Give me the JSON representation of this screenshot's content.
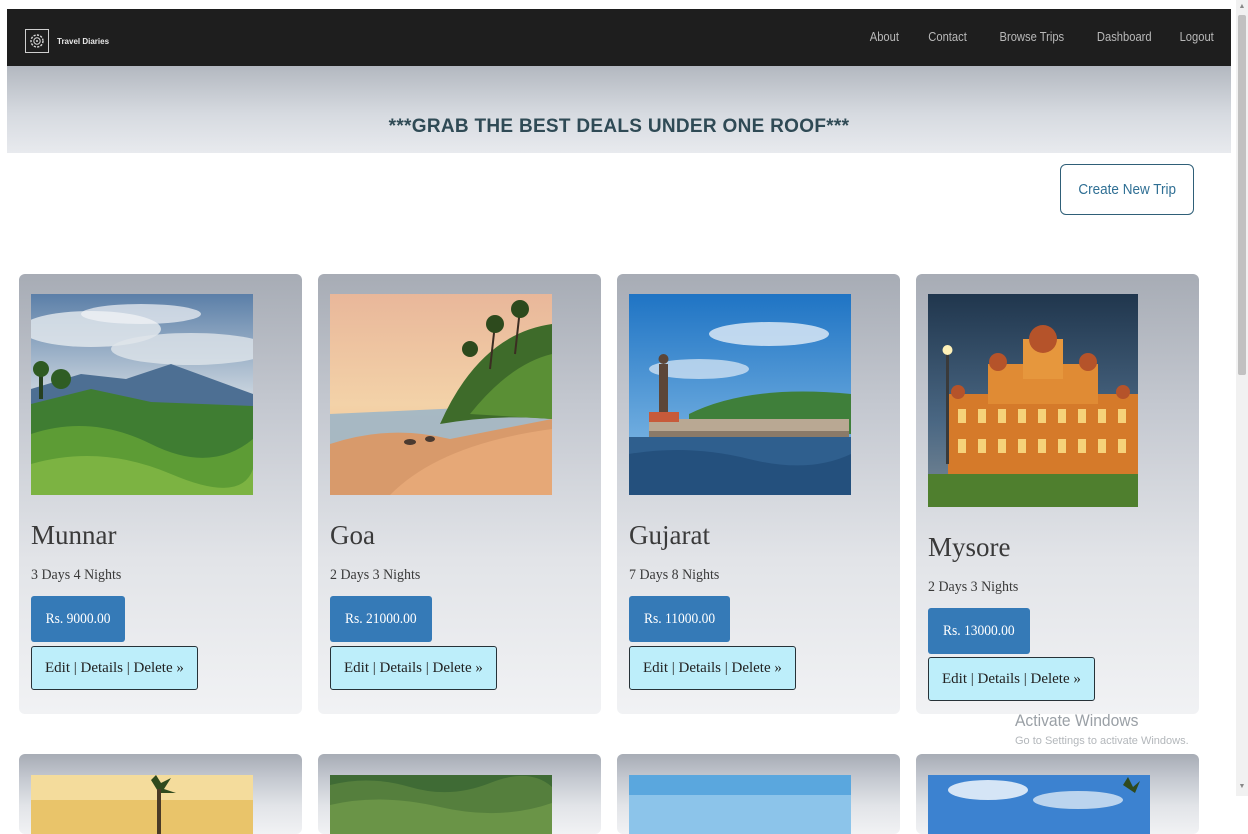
{
  "brand": {
    "name": "Travel Diaries",
    "icon": "gear-logo-icon"
  },
  "nav": {
    "items": [
      {
        "label": "About"
      },
      {
        "label": "Contact"
      },
      {
        "label": "Browse Trips"
      },
      {
        "label": "Dashboard"
      },
      {
        "label": "Logout"
      }
    ]
  },
  "banner": {
    "text": "***GRAB THE BEST DEALS UNDER ONE ROOF***"
  },
  "create_button": {
    "label": "Create New Trip"
  },
  "trips": [
    {
      "name": "Munnar",
      "duration": "3 Days 4 Nights",
      "price": "Rs. 9000.00",
      "actions": "Edit | Details | Delete »"
    },
    {
      "name": "Goa",
      "duration": "2 Days 3 Nights",
      "price": "Rs. 21000.00",
      "actions": "Edit | Details | Delete »"
    },
    {
      "name": "Gujarat",
      "duration": "7 Days 8 Nights",
      "price": "Rs. 11000.00",
      "actions": "Edit | Details | Delete »"
    },
    {
      "name": "Mysore",
      "duration": "2 Days 3 Nights",
      "price": "Rs. 13000.00",
      "actions": "Edit | Details | Delete »"
    }
  ],
  "watermark": {
    "title": "Activate Windows",
    "subtitle": "Go to Settings to activate Windows."
  },
  "colors": {
    "navbar": "#1e1e1e",
    "price_button": "#357ab7",
    "actions_button": "#bdeefa",
    "banner_text": "#2f4a55"
  }
}
